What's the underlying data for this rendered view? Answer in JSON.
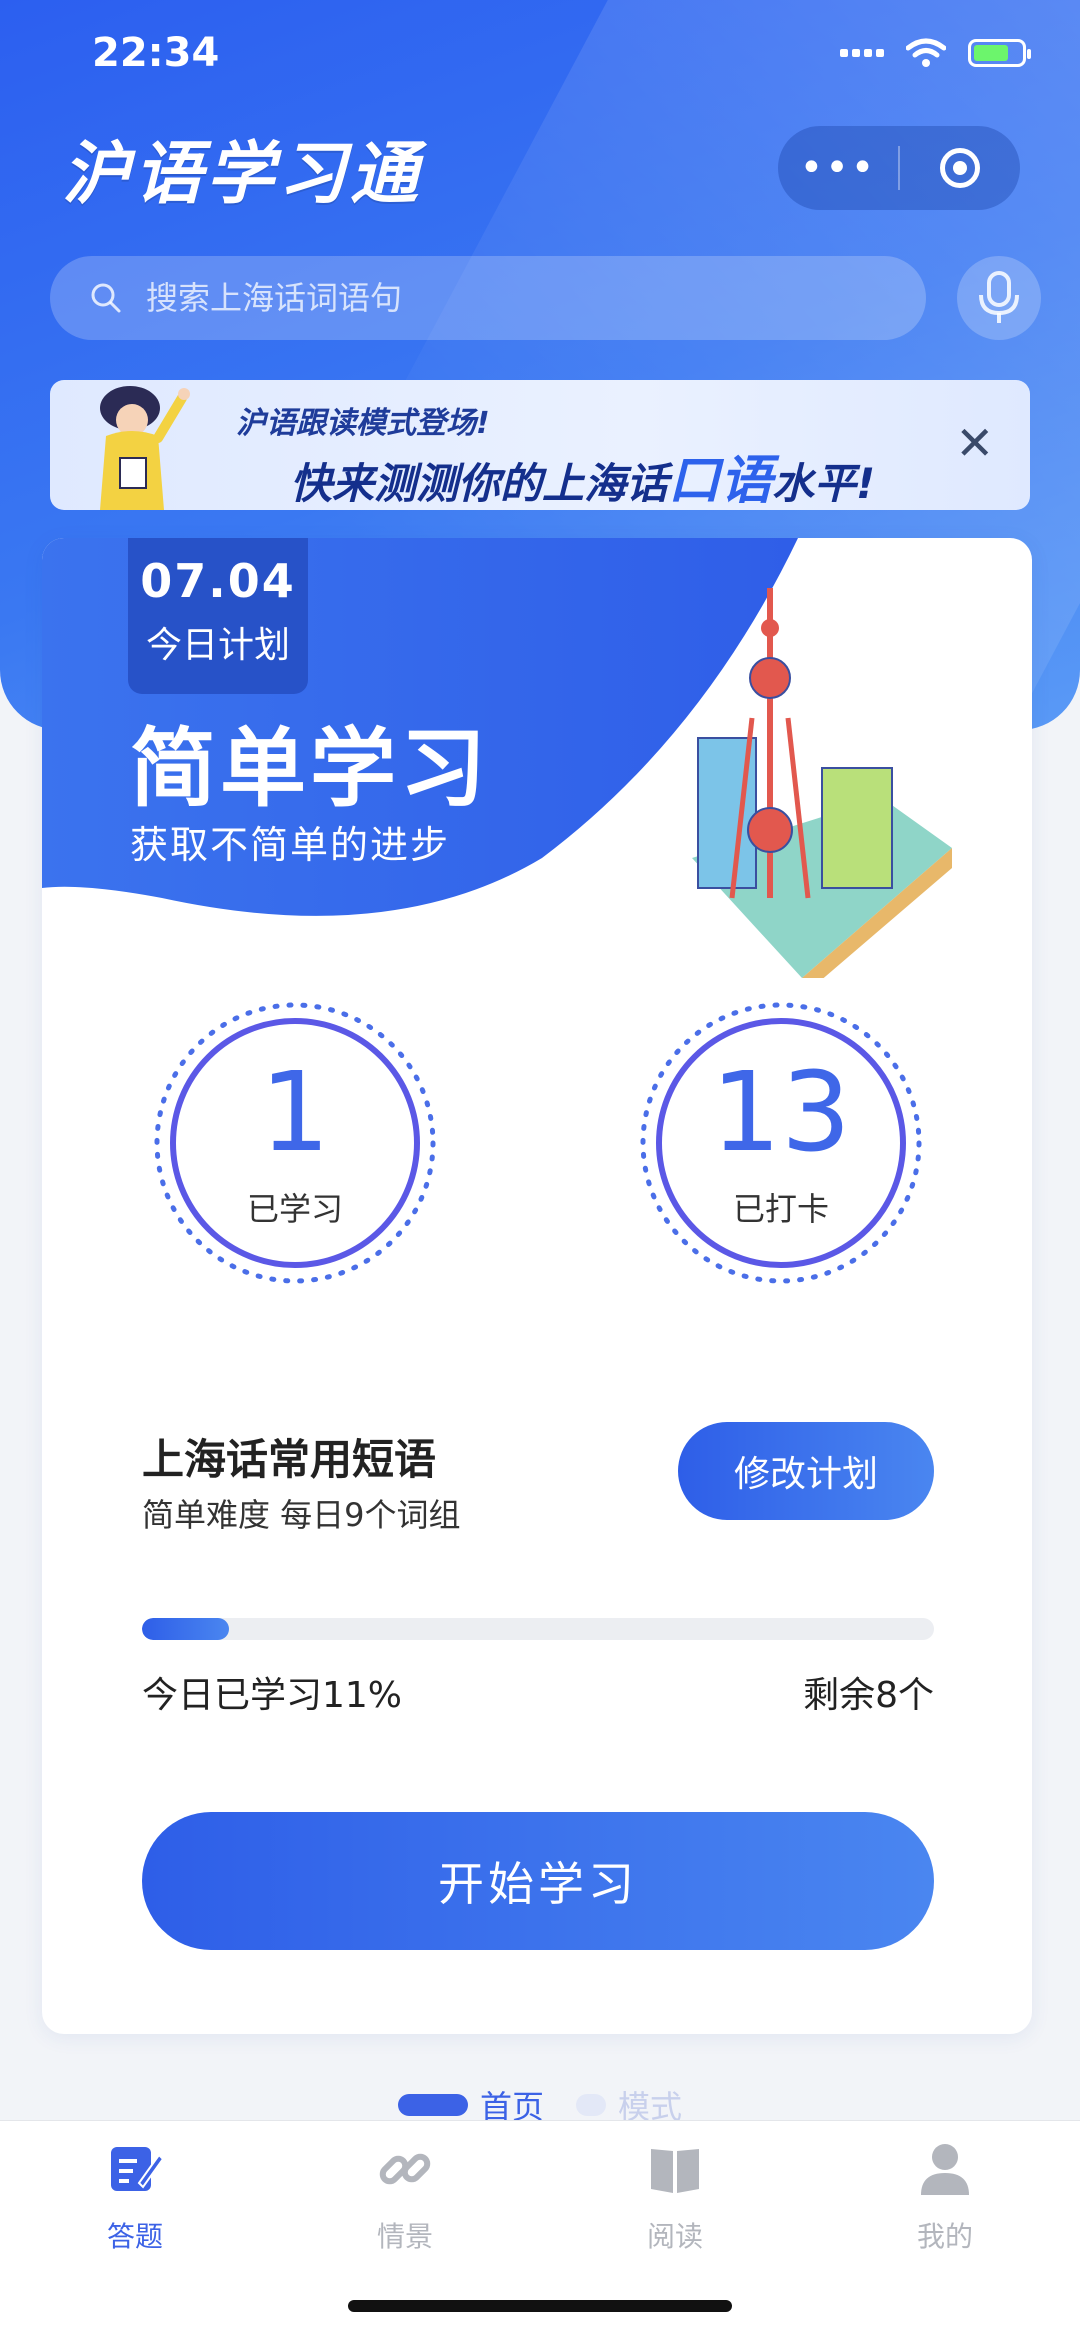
{
  "status_bar": {
    "time": "22:34"
  },
  "header": {
    "app_title": "沪语学习通"
  },
  "search": {
    "placeholder": "搜索上海话词语句"
  },
  "banner": {
    "line1": "沪语跟读模式登场!",
    "line2_pre": "快来测测你的上海话",
    "line2_highlight": "口语",
    "line2_post": "水平!"
  },
  "plan_card": {
    "date": "07.04",
    "date_label": "今日计划",
    "slogan": "简单学习",
    "slogan_sub": "获取不简单的进步",
    "stats": [
      {
        "value": "1",
        "label": "已学习"
      },
      {
        "value": "13",
        "label": "已打卡"
      }
    ],
    "course_title": "上海话常用短语",
    "course_sub": "简单难度 每日9个词组",
    "edit_button": "修改计划",
    "progress_percent": 11,
    "progress_text": "今日已学习11%",
    "remaining_text": "剩余8个",
    "start_button": "开始学习"
  },
  "pager": {
    "active": "首页",
    "inactive": "模式"
  },
  "tabbar": {
    "items": [
      {
        "label": "答题",
        "icon": "quiz-icon",
        "active": true
      },
      {
        "label": "情景",
        "icon": "link-icon",
        "active": false
      },
      {
        "label": "阅读",
        "icon": "book-icon",
        "active": false
      },
      {
        "label": "我的",
        "icon": "user-icon",
        "active": false
      }
    ]
  },
  "colors": {
    "primary": "#3c62e6",
    "accent_dark": "#2752c8",
    "inactive_tab": "#b3b6bd"
  }
}
